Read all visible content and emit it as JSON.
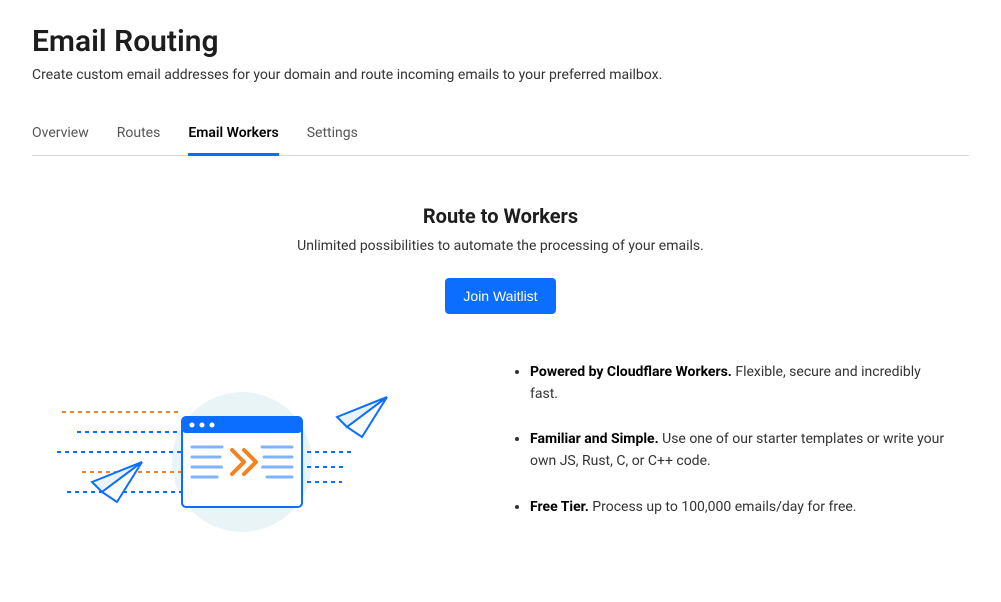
{
  "header": {
    "title": "Email Routing",
    "subtitle": "Create custom email addresses for your domain and route incoming emails to your preferred mailbox."
  },
  "tabs": [
    {
      "label": "Overview",
      "active": false
    },
    {
      "label": "Routes",
      "active": false
    },
    {
      "label": "Email Workers",
      "active": true
    },
    {
      "label": "Settings",
      "active": false
    }
  ],
  "hero": {
    "title": "Route to Workers",
    "subtitle": "Unlimited possibilities to automate the processing of your emails.",
    "cta_label": "Join Waitlist"
  },
  "features": [
    {
      "bold": "Powered by Cloudflare Workers.",
      "rest": " Flexible, secure and incredibly fast."
    },
    {
      "bold": "Familiar and Simple.",
      "rest": " Use one of our starter templates or write your own JS, Rust, C, or C++ code."
    },
    {
      "bold": "Free Tier.",
      "rest": " Process up to 100,000 emails/day for free."
    }
  ],
  "colors": {
    "accent": "#0c6eff",
    "orange": "#f6821f"
  }
}
